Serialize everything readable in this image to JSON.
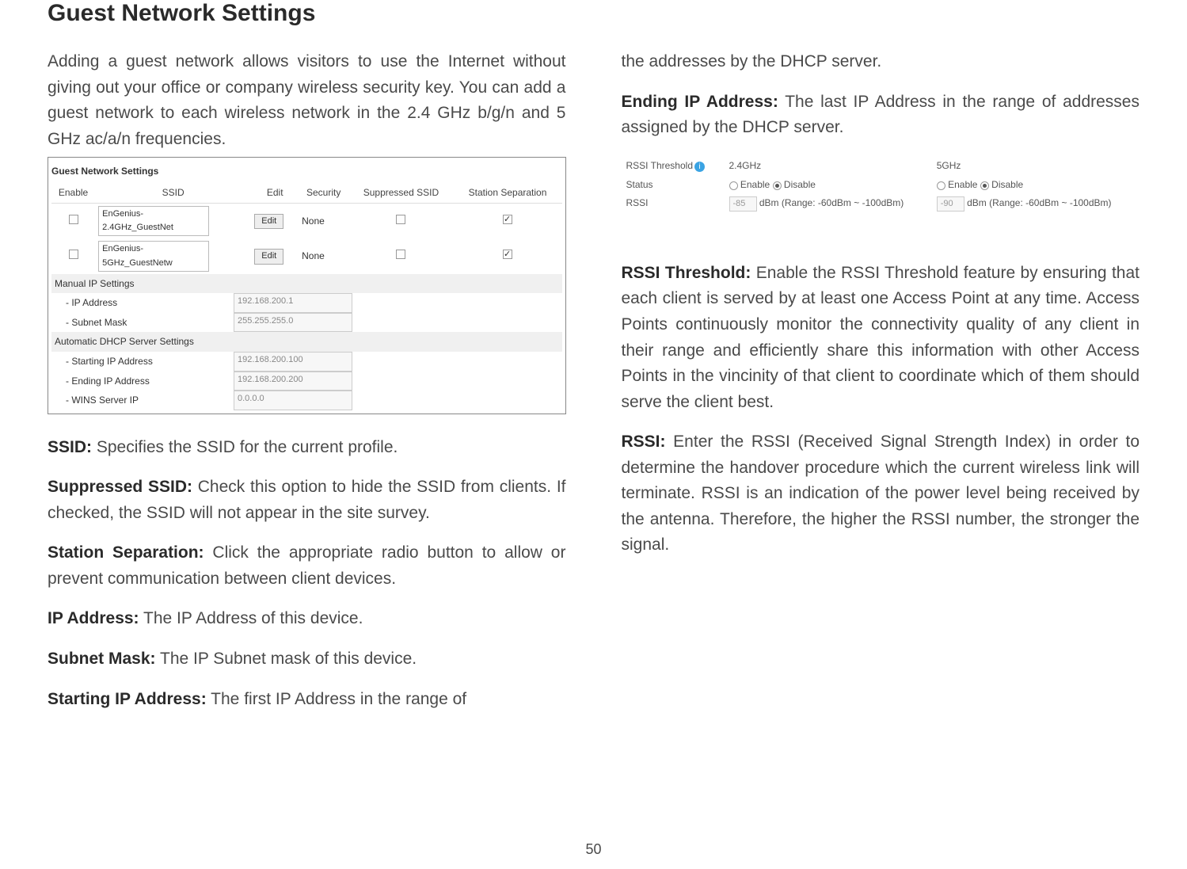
{
  "title": "Guest Network Settings",
  "page_number": "50",
  "intro": "Adding a guest network allows visitors to use the Internet without giving out your office or company wireless security key. You can add a guest network to each wireless network in the  2.4 GHz b/g/n and 5 GHz ac/a/n frequencies.",
  "fig1": {
    "heading": "Guest Network Settings",
    "cols": [
      "Enable",
      "SSID",
      "Edit",
      "Security",
      "Suppressed SSID",
      "Station Separation"
    ],
    "rows": [
      {
        "enabled": false,
        "ssid": "EnGenius-2.4GHz_GuestNet",
        "edit": "Edit",
        "security": "None",
        "suppressed": false,
        "separation": true
      },
      {
        "enabled": false,
        "ssid": "EnGenius-5GHz_GuestNetw",
        "edit": "Edit",
        "security": "None",
        "suppressed": false,
        "separation": true
      }
    ],
    "manual_heading": "Manual IP Settings",
    "manual": [
      {
        "label": "- IP Address",
        "value": "192.168.200.1"
      },
      {
        "label": "- Subnet Mask",
        "value": "255.255.255.0"
      }
    ],
    "dhcp_heading": "Automatic DHCP Server Settings",
    "dhcp": [
      {
        "label": "- Starting IP Address",
        "value": "192.168.200.100"
      },
      {
        "label": "- Ending IP Address",
        "value": "192.168.200.200"
      },
      {
        "label": "- WINS Server IP",
        "value": "0.0.0.0"
      }
    ]
  },
  "defs_left": [
    {
      "term": "SSID:",
      "text": " Specifies the SSID for the current profile."
    },
    {
      "term": "Suppressed SSID:",
      "text": " Check this option to hide the SSID from clients. If checked, the SSID will not appear in the site survey."
    },
    {
      "term": "Station Separation:",
      "text": " Click the appropriate radio button to allow or prevent communication between client devices."
    },
    {
      "term": "IP Address:",
      "text": " The IP Address of this device."
    },
    {
      "term": "Subnet Mask:",
      "text": " The IP Subnet mask of this device."
    },
    {
      "term": "Starting IP Address:",
      "text": " The first IP Address in the range of"
    }
  ],
  "right_top": "the addresses by the DHCP server.",
  "defs_right1": {
    "term": "Ending IP Address:",
    "text": " The last IP Address in the range of addresses assigned by the DHCP server."
  },
  "fig2": {
    "label_threshold": "RSSI Threshold",
    "info": "i",
    "col24": "2.4GHz",
    "col5": "5GHz",
    "label_status": "Status",
    "enable": "Enable",
    "disable": "Disable",
    "label_rssi": "RSSI",
    "val24": "-85",
    "val5": "-90",
    "range": "dBm (Range: -60dBm ~ -100dBm)"
  },
  "defs_right2": [
    {
      "term": "RSSI Threshold:",
      "text": " Enable the RSSI Threshold feature by ensuring that each client is served by at least one Access Point at any time. Access Points continuously monitor the connectivity quality of any client in their range and efficiently share this information with other Access Points in the vincinity of that client to coordinate which of them should serve the client best."
    },
    {
      "term": "RSSI:",
      "text": " Enter the RSSI (Received Signal Strength Index) in order to determine the handover procedure which the current wireless link will terminate. RSSI is an indication of the power level being received by the antenna. Therefore, the higher the RSSI number, the stronger the signal."
    }
  ]
}
